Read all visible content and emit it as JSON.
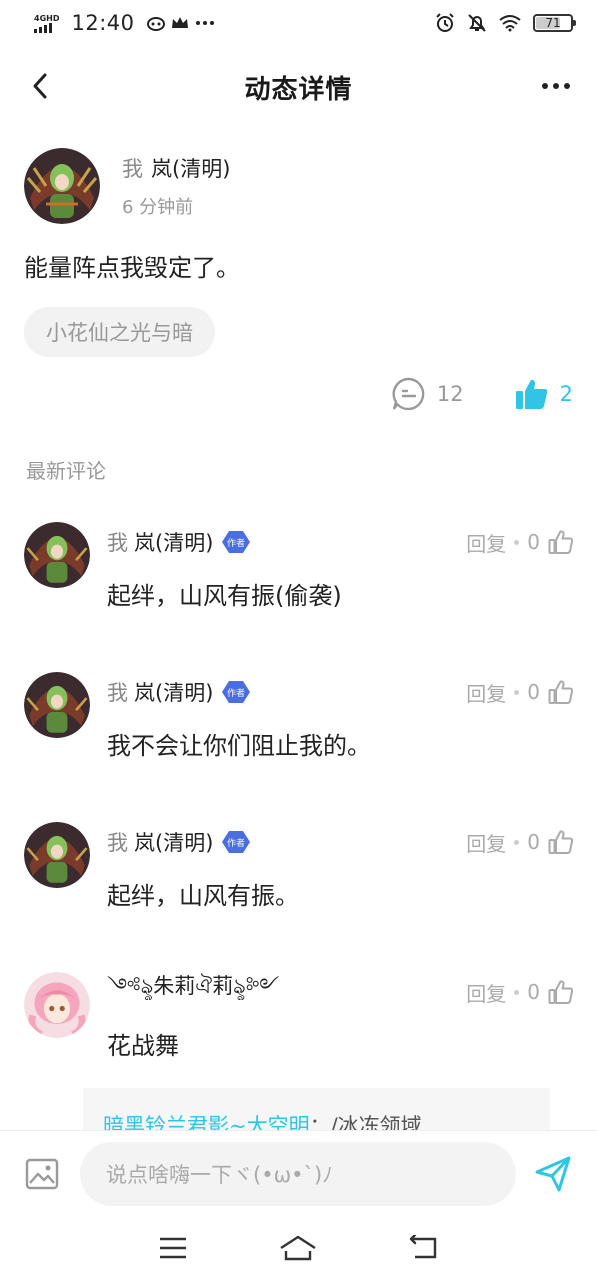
{
  "status_bar": {
    "network": "4GHD",
    "time": "12:40",
    "battery": "71",
    "battery_level": 0.71
  },
  "header": {
    "title": "动态详情"
  },
  "post": {
    "author_prefix": "我",
    "author_name": "岚(清明)",
    "time": "6 分钟前",
    "content": "能量阵点我毁定了。",
    "tag": "小花仙之光与暗",
    "comment_count": "12",
    "like_count": "2"
  },
  "comments_section": {
    "label": "最新评论",
    "reply_label": "回复",
    "author_badge": "作者",
    "items": [
      {
        "prefix": "我",
        "name": "岚(清明)",
        "text": "起绊，山风有振(偷袭)",
        "likes": "0"
      },
      {
        "prefix": "我",
        "name": "岚(清明)",
        "text": "我不会让你们阻止我的。",
        "likes": "0"
      },
      {
        "prefix": "我",
        "name": "岚(清明)",
        "text": "起绊，山风有振。",
        "likes": "0"
      },
      {
        "prefix": "",
        "name": "༺ৡ朱莉ঐ莉ৡ༻",
        "text": "花战舞",
        "likes": "0"
      }
    ],
    "reply_preview": {
      "name": "暗黑铃兰君影~大空明",
      "separator": "：",
      "text": "/冰冻领域"
    }
  },
  "input_bar": {
    "placeholder": "说点啥嗨一下ヾ(•ω•`)ﾉ"
  },
  "colors": {
    "accent": "#2fc5e3",
    "badge": "#4a6ee0",
    "muted": "#999999"
  }
}
